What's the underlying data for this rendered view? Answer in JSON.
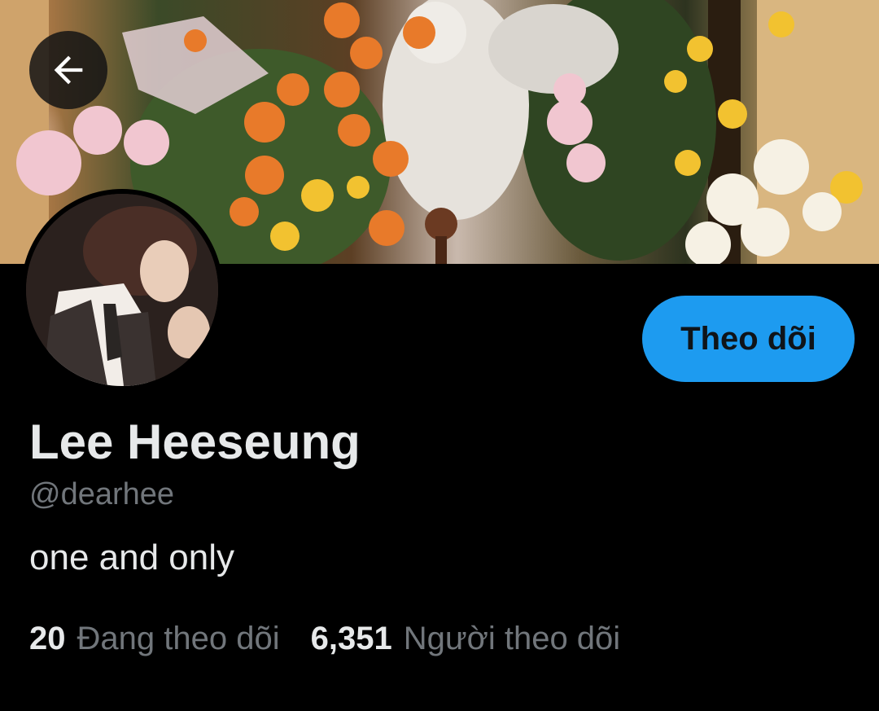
{
  "header": {
    "back_icon": "arrow-left-icon",
    "banner_alt": "Cover photo: bouquet of orange, pink and white flowers around a white angel statue"
  },
  "profile": {
    "display_name": "Lee Heeseung",
    "handle": "@dearhee",
    "bio": "one and only",
    "follow_label": "Theo dõi"
  },
  "stats": {
    "following_count": "20",
    "following_label": "Đang theo dõi",
    "followers_count": "6,351",
    "followers_label": "Người theo dõi"
  },
  "colors": {
    "background": "#000000",
    "accent": "#1d9bf0",
    "primary_text": "#e7e9ea",
    "secondary_text": "#71767b"
  }
}
